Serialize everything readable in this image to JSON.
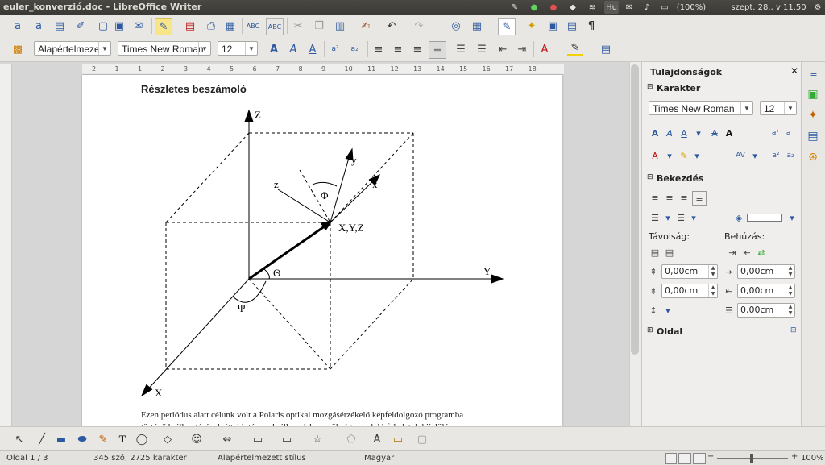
{
  "window": {
    "title": "euler_konverzió.doc - LibreOffice Writer"
  },
  "system_tray": {
    "keyboard_layout": "Hu",
    "battery": "(100%)",
    "clock": "szept. 28., v 11.50"
  },
  "format_toolbar": {
    "paragraph_style": "Alapértelmeze",
    "font_name": "Times New Roman",
    "font_size": "12"
  },
  "ruler": {
    "ticks": [
      "2",
      "1",
      "1",
      "2",
      "3",
      "4",
      "5",
      "6",
      "7",
      "8",
      "9",
      "10",
      "11",
      "12",
      "13",
      "14",
      "15",
      "16",
      "17",
      "18"
    ]
  },
  "document": {
    "heading": "Részletes beszámoló",
    "figure_labels": {
      "Z": "Z",
      "y": "y",
      "x": "x",
      "z": "z",
      "phi": "Φ",
      "xyz": "X,Y,Z",
      "theta": "Θ",
      "Y": "Y",
      "psi": "Ψ",
      "X": "X"
    },
    "paragraph_line1": "Ezen periódus alatt célunk volt a Polaris optikai mozgásérzékelő képfeldolgozó programba",
    "paragraph_line2": "történő beillesztésének áttekintése, a beillesztéshez szükséges induló feladatok kijelölése"
  },
  "sidebar": {
    "title": "Tulajdonságok",
    "character": {
      "header": "Karakter",
      "font_name": "Times New Roman",
      "font_size": "12"
    },
    "paragraph": {
      "header": "Bekezdés",
      "spacing_label": "Távolság:",
      "indent_label": "Behúzás:",
      "above": "0,00cm",
      "below": "0,00cm",
      "before_text": "0,00cm",
      "after_text": "0,00cm",
      "first_line": "0,00cm"
    },
    "page": {
      "header": "Oldal"
    }
  },
  "statusbar": {
    "page": "Oldal 1 / 3",
    "words": "345 szó, 2725 karakter",
    "style": "Alapértelmezett stílus",
    "language": "Magyar",
    "zoom": "100%"
  },
  "colors": {
    "accent": "#2c5aa0",
    "topbar": "#3c3b37",
    "highlight": "#f5d000",
    "font_color": "#c01010"
  }
}
